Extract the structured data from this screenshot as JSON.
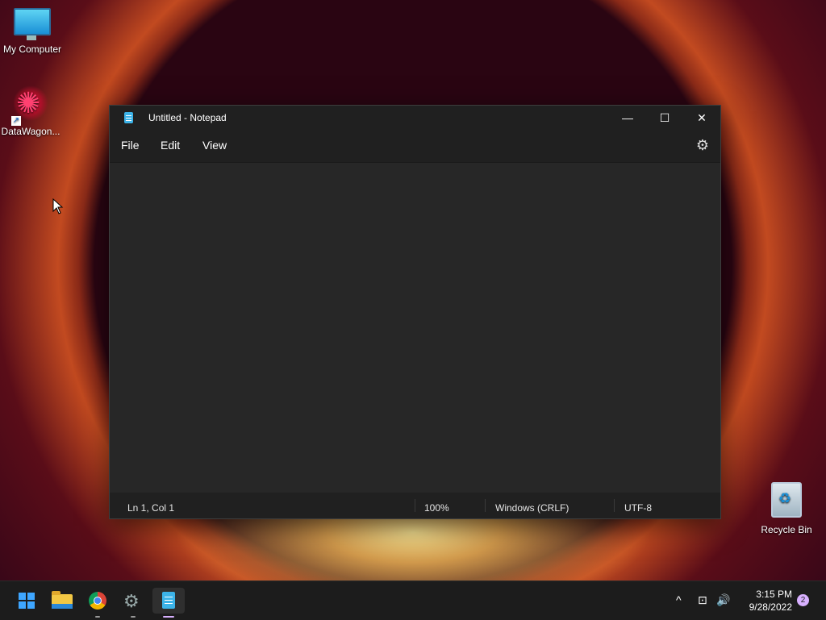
{
  "desktop": {
    "icons": [
      {
        "label": "My Computer"
      },
      {
        "label": "DataWagon..."
      },
      {
        "label": "Recycle Bin"
      }
    ]
  },
  "notepad": {
    "title": "Untitled - Notepad",
    "caption": {
      "minimize": "—",
      "maximize": "☐",
      "close": "✕"
    },
    "menu": [
      "File",
      "Edit",
      "View"
    ],
    "settings_icon": "gear-icon",
    "content": "",
    "status": {
      "position": "Ln 1, Col 1",
      "zoom": "100%",
      "line_ending": "Windows (CRLF)",
      "encoding": "UTF-8"
    }
  },
  "taskbar": {
    "apps": [
      "start-icon",
      "file-explorer-icon",
      "chrome-icon",
      "settings-icon",
      "notepad-icon"
    ],
    "active_app": "notepad-icon",
    "tray": {
      "chevron": "^",
      "network": "⊡",
      "volume": "🔊"
    },
    "time": "3:15 PM",
    "date": "9/28/2022",
    "notifications": "2"
  },
  "colors": {
    "accent": "#3ea6ff",
    "window_bg": "#272727",
    "titlebar_bg": "#202020",
    "taskbar_bg": "#1c1c1c"
  }
}
